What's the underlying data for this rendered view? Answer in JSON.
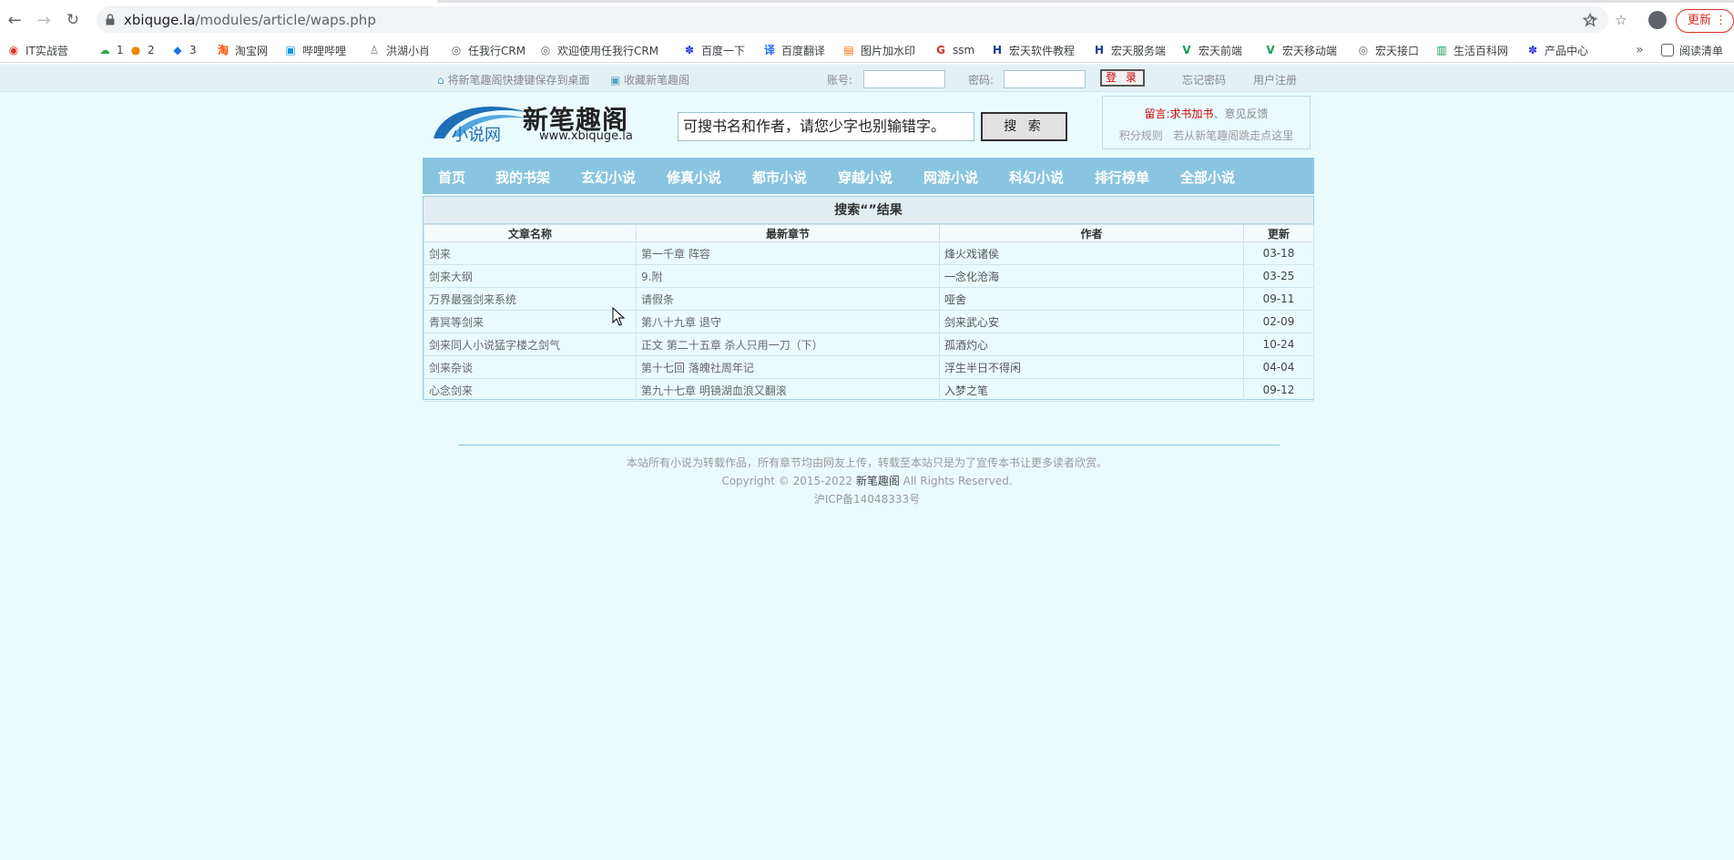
{
  "browser": {
    "url_domain": "xbiquge.la",
    "url_path": "/modules/article/waps.php",
    "update_label": "更新",
    "bookmarks": [
      {
        "label": "IT实战营",
        "icon": "red",
        "color": "#d93025"
      },
      {
        "label": "1",
        "icon": "cloud",
        "color": "#34a853"
      },
      {
        "label": "2",
        "icon": "circle",
        "color": "#ea8600"
      },
      {
        "label": "3",
        "icon": "bird",
        "color": "#1a73e8"
      },
      {
        "label": "淘宝网",
        "icon": "taobao",
        "color": "#ff5000"
      },
      {
        "label": "哔哩哔哩",
        "icon": "tv",
        "color": "#1296db"
      },
      {
        "label": "洪湖小肖",
        "icon": "figure",
        "color": "#777777"
      },
      {
        "label": "任我行CRM",
        "icon": "globe",
        "color": "#5f6368"
      },
      {
        "label": "欢迎使用任我行CRM",
        "icon": "globe",
        "color": "#5f6368"
      },
      {
        "label": "百度一下",
        "icon": "paw",
        "color": "#2932e1"
      },
      {
        "label": "百度翻译",
        "icon": "translate",
        "color": "#2468f2"
      },
      {
        "label": "图片加水印",
        "icon": "image",
        "color": "#ff6a00"
      },
      {
        "label": "ssm",
        "icon": "ssm",
        "color": "#d93025"
      },
      {
        "label": "宏天软件教程",
        "icon": "H",
        "color": "#1a3c8f"
      },
      {
        "label": "宏天服务端",
        "icon": "H",
        "color": "#1a3c8f"
      },
      {
        "label": "宏天前端",
        "icon": "V",
        "color": "#0f9d58"
      },
      {
        "label": "宏天移动端",
        "icon": "V",
        "color": "#0f9d58"
      },
      {
        "label": "宏天接口",
        "icon": "globe",
        "color": "#5f6368"
      },
      {
        "label": "生活百科网",
        "icon": "book",
        "color": "#0f9d58"
      },
      {
        "label": "产品中心",
        "icon": "paw",
        "color": "#2932e1"
      }
    ],
    "overflow_label": "»",
    "reading_list_label": "阅读清单"
  },
  "topbar": {
    "save_desktop": "将新笔趣阁快捷键保存到桌面",
    "favorite": "收藏新笔趣阁",
    "account_label": "账号:",
    "password_label": "密码:",
    "login_button": "登 录",
    "forgot_password": "忘记密码",
    "register": "用户注册"
  },
  "header": {
    "site_name": "新笔趣阁",
    "logo_sub": "小说网",
    "logo_url": "www.xbiquge.la",
    "search_value": "可搜书名和作者，请您少字也别输错字。",
    "search_button": "搜 索",
    "notice_prefix": "留言:",
    "notice_request": "求书加书",
    "notice_sep": "、",
    "notice_feedback": "意见反馈",
    "notice_rules": "积分规则",
    "notice_tip": "若从新笔趣阁跳走点这里"
  },
  "nav": [
    "首页",
    "我的书架",
    "玄幻小说",
    "修真小说",
    "都市小说",
    "穿越小说",
    "网游小说",
    "科幻小说",
    "排行榜单",
    "全部小说"
  ],
  "results": {
    "title": "搜索“”结果",
    "columns": [
      "文章名称",
      "最新章节",
      "作者",
      "更新"
    ],
    "rows": [
      {
        "name": "剑来",
        "chapter": "第一千章 阵容",
        "author": "烽火戏诸侯",
        "date": "03-18"
      },
      {
        "name": "剑来大纲",
        "chapter": "9.附",
        "author": "一念化沧海",
        "date": "03-25"
      },
      {
        "name": "万界最强剑来系统",
        "chapter": "请假条",
        "author": "哑舍",
        "date": "09-11"
      },
      {
        "name": "青冥等剑来",
        "chapter": "第八十九章 退守",
        "author": "剑来武心安",
        "date": "02-09"
      },
      {
        "name": "剑来同人小说猛字楼之剑气",
        "chapter": "正文 第二十五章 杀人只用一刀（下）",
        "author": "孤酒灼心",
        "date": "10-24"
      },
      {
        "name": "剑来杂谈",
        "chapter": "第十七回 落魄社周年记",
        "author": "浮生半日不得闲",
        "date": "04-04"
      },
      {
        "name": "心念剑来",
        "chapter": "第九十七章 明镜湖血浪又翻滚",
        "author": "入梦之笔",
        "date": "09-12"
      }
    ]
  },
  "footer": {
    "disclaimer": "本站所有小说为转载作品，所有章节均由网友上传，转载至本站只是为了宣传本书让更多读者欣赏。",
    "copyright_pre": "Copyright © 2015-2022 ",
    "copyright_site": "新笔趣阁",
    "copyright_post": " All Rights Reserved.",
    "icp": "沪ICP备14048333号"
  }
}
